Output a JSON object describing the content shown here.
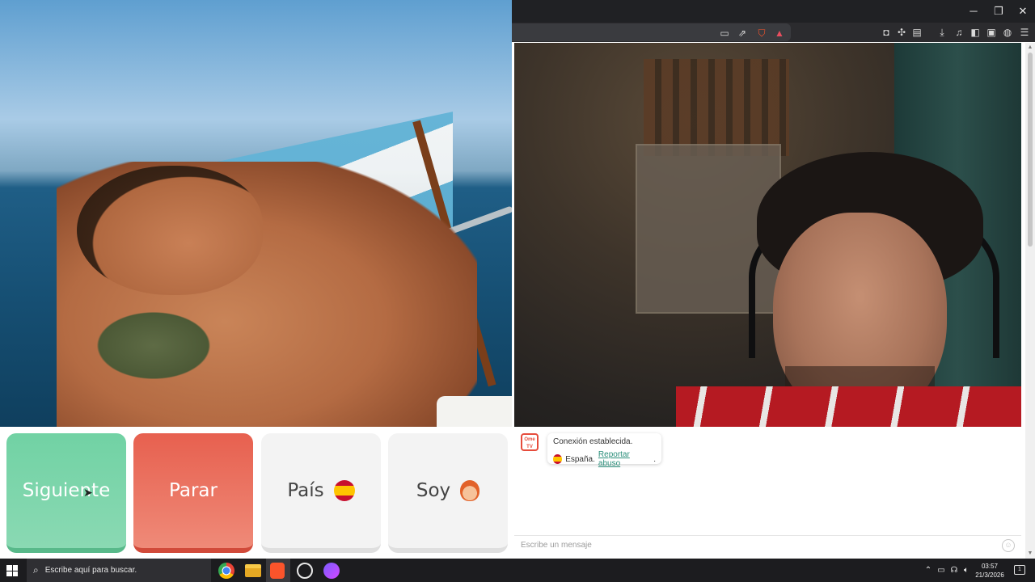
{
  "window": {
    "controls": {
      "minimize": "─",
      "restore": "❐",
      "close": "✕"
    }
  },
  "toolbar_icons": [
    "cast-icon",
    "share-icon",
    "brave-shield-icon",
    "brave-rewards-icon",
    "extension-icon",
    "puzzle-icon",
    "tab-search-icon",
    "download-icon",
    "media-icon",
    "sidebar-icon",
    "wallet-icon",
    "vpn-icon",
    "menu-icon"
  ],
  "controls": {
    "next_label": "Siguiente",
    "stop_label": "Parar",
    "country_label": "País",
    "me_label": "Soy"
  },
  "chat": {
    "logo_text": "Ome TV",
    "status": "Conexión establecida.",
    "country": "España.",
    "report_label": "Reportar abuso",
    "report_suffix": ".",
    "input_placeholder": "Escribe un mensaje",
    "emoji_glyph": "☺"
  },
  "taskbar": {
    "search_placeholder": "Escribe aquí para buscar.",
    "time": "03:57",
    "date": "21/3/2026",
    "notification_count": "1"
  },
  "colors": {
    "next": "#71d2a4",
    "stop": "#e7604f",
    "link": "#2a8e7a"
  }
}
